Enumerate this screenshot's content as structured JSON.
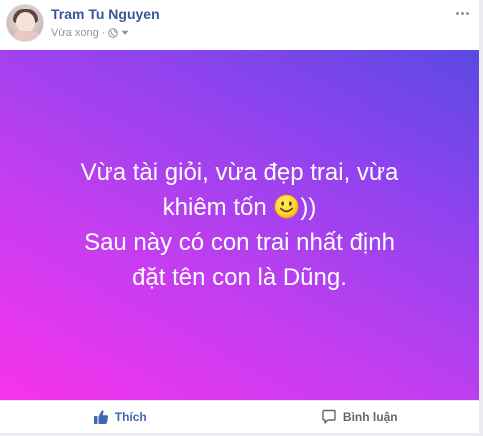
{
  "post": {
    "author_name": "Tram Tu Nguyen",
    "timestamp": "Vừa xong",
    "separator": "·",
    "privacy_icon": "globe-icon",
    "menu_icon": "more-options-icon",
    "background_colors": [
      "#f733ec",
      "#c23ef0",
      "#8f43ee",
      "#5b49e3"
    ],
    "text_lines": {
      "line1": "Vừa tài giỏi, vừa đẹp trai, vừa",
      "line2_before": "khiêm tốn",
      "line2_after": "))",
      "line3": "Sau này có con trai nhất định",
      "line4": "đặt tên con là Dũng."
    },
    "emoji": "smiley-emoji"
  },
  "actions": {
    "like_label": "Thích",
    "comment_label": "Bình luận",
    "like_icon": "thumbs-up-icon",
    "comment_icon": "comment-bubble-icon",
    "like_color": "#4267b2",
    "comment_color": "#616770"
  }
}
